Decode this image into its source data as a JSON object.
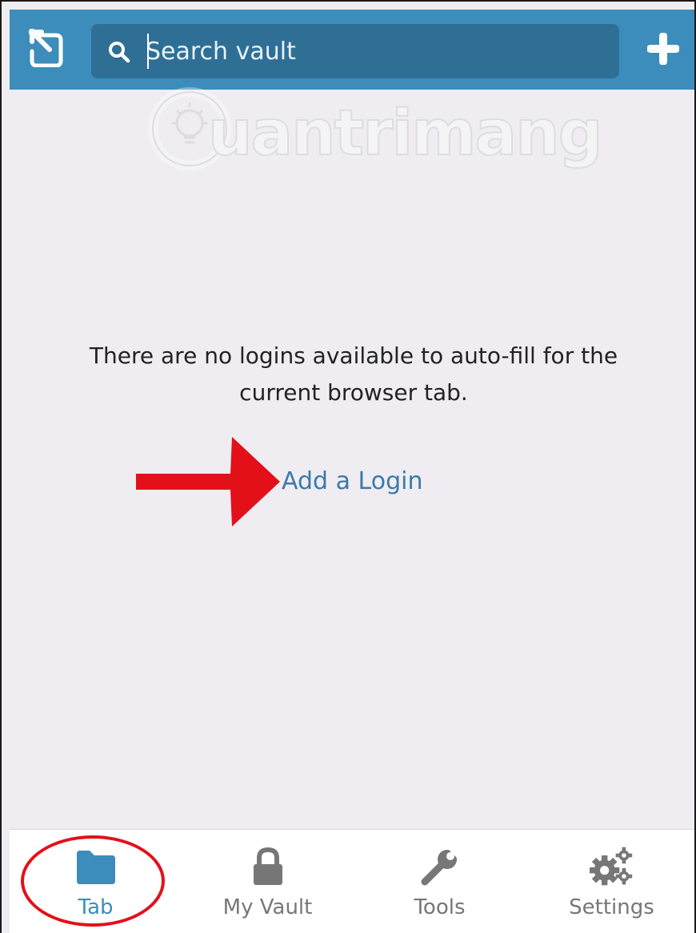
{
  "header": {
    "popout_icon": "popout-icon",
    "search": {
      "placeholder": "Search vault",
      "value": "",
      "icon": "search-icon"
    },
    "add_icon": "plus-icon",
    "background_color": "#3c8dbc"
  },
  "watermark": {
    "text": "uantrimang",
    "icon": "lightbulb-logo"
  },
  "main": {
    "message_line1": "There are no logins available to auto-fill for the",
    "message_line2": "current browser tab.",
    "add_login_label": "Add a Login",
    "link_color": "#3c7aa8",
    "annotation_arrow_color": "#e3101a"
  },
  "tabs": [
    {
      "label": "Tab",
      "icon": "folder-icon",
      "active": true
    },
    {
      "label": "My Vault",
      "icon": "lock-icon",
      "active": false
    },
    {
      "label": "Tools",
      "icon": "wrench-icon",
      "active": false
    },
    {
      "label": "Settings",
      "icon": "gears-icon",
      "active": false
    }
  ],
  "annotation_circle_color": "#e3101a"
}
